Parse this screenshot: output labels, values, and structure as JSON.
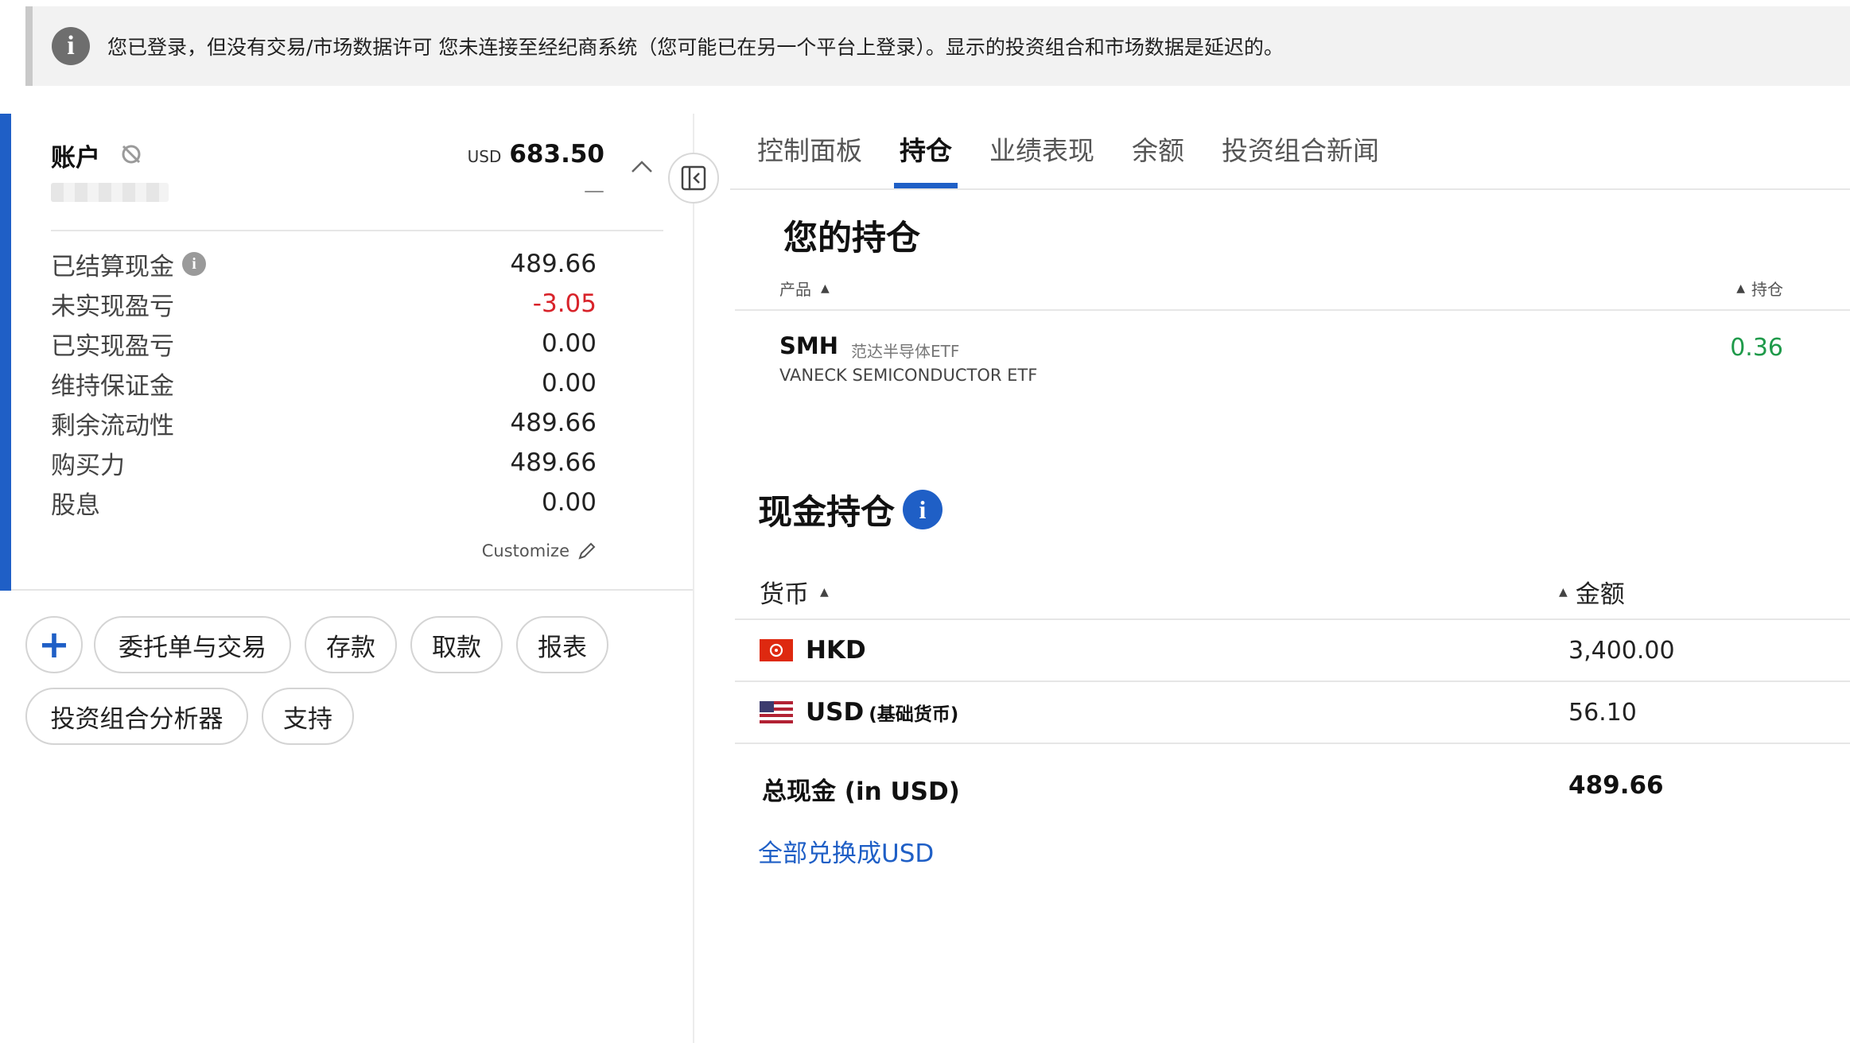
{
  "notice": {
    "text": "您已登录，但没有交易/市场数据许可 您未连接至经纪商系统（您可能已在另一个平台上登录）。显示的投资组合和市场数据是延迟的。"
  },
  "account": {
    "title": "账户",
    "currency": "USD",
    "value": "683.50",
    "change": "—",
    "metrics": [
      {
        "label": "已结算现金",
        "value": "489.66"
      },
      {
        "label": "未实现盈亏",
        "value": "-3.05"
      },
      {
        "label": "已实现盈亏",
        "value": "0.00"
      },
      {
        "label": "维持保证金",
        "value": "0.00"
      },
      {
        "label": "剩余流动性",
        "value": "489.66"
      },
      {
        "label": "购买力",
        "value": "489.66"
      },
      {
        "label": "股息",
        "value": "0.00"
      }
    ],
    "customize_label": "Customize"
  },
  "actions": {
    "add": "+",
    "orders": "委托单与交易",
    "deposit": "存款",
    "withdraw": "取款",
    "reports": "报表",
    "analyzer": "投资组合分析器",
    "support": "支持"
  },
  "tabs": [
    {
      "label": "控制面板"
    },
    {
      "label": "持仓"
    },
    {
      "label": "业绩表现"
    },
    {
      "label": "余额"
    },
    {
      "label": "投资组合新闻"
    }
  ],
  "positions": {
    "heading": "您的持仓",
    "col_product": "产品",
    "col_position": "持仓",
    "rows": [
      {
        "symbol": "SMH",
        "name_cn": "范达半导体ETF",
        "name_en": "VANECK SEMICONDUCTOR ETF",
        "qty": "0.36"
      }
    ]
  },
  "cash": {
    "heading": "现金持仓",
    "col_currency": "货币",
    "col_amount": "金额",
    "rows": [
      {
        "currency": "HKD",
        "note": "",
        "amount": "3,400.00"
      },
      {
        "currency": "USD",
        "note": "(基础货币)",
        "amount": "56.10"
      }
    ],
    "total_label": "总现金 (in USD)",
    "total_amount": "489.66",
    "convert_link": "全部兑换成USD"
  },
  "colors": {
    "accent": "#1f5fc6",
    "negative": "#d8232a",
    "positive": "#1f9a4a"
  }
}
